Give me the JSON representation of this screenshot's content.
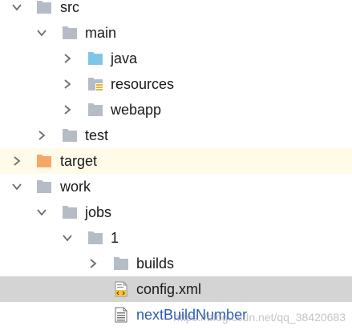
{
  "tree": {
    "nodes": [
      {
        "label": "src",
        "expanded": true,
        "icon": "folder-icon",
        "color": "#b5bcc6"
      },
      {
        "label": "main",
        "expanded": true,
        "icon": "folder-icon",
        "color": "#b5bcc6"
      },
      {
        "label": "java",
        "expanded": false,
        "icon": "source-folder-icon",
        "color": "#7fc6e6"
      },
      {
        "label": "resources",
        "expanded": false,
        "icon": "resources-folder-icon",
        "color": "#b5bcc6"
      },
      {
        "label": "webapp",
        "expanded": false,
        "icon": "folder-icon",
        "color": "#b5bcc6"
      },
      {
        "label": "test",
        "expanded": false,
        "icon": "folder-icon",
        "color": "#b5bcc6"
      },
      {
        "label": "target",
        "expanded": false,
        "icon": "excluded-folder-icon",
        "color": "#f4a768"
      },
      {
        "label": "work",
        "expanded": true,
        "icon": "folder-icon",
        "color": "#b5bcc6"
      },
      {
        "label": "jobs",
        "expanded": true,
        "icon": "folder-icon",
        "color": "#b5bcc6"
      },
      {
        "label": "1",
        "expanded": true,
        "icon": "folder-icon",
        "color": "#b5bcc6"
      },
      {
        "label": "builds",
        "expanded": false,
        "icon": "folder-icon",
        "color": "#b5bcc6"
      },
      {
        "label": "config.xml",
        "icon": "xml-file-icon",
        "selected": true
      },
      {
        "label": "nextBuildNumber",
        "icon": "text-file-icon"
      }
    ]
  },
  "watermark": "https://blog.csdn.net/qq_38420683"
}
